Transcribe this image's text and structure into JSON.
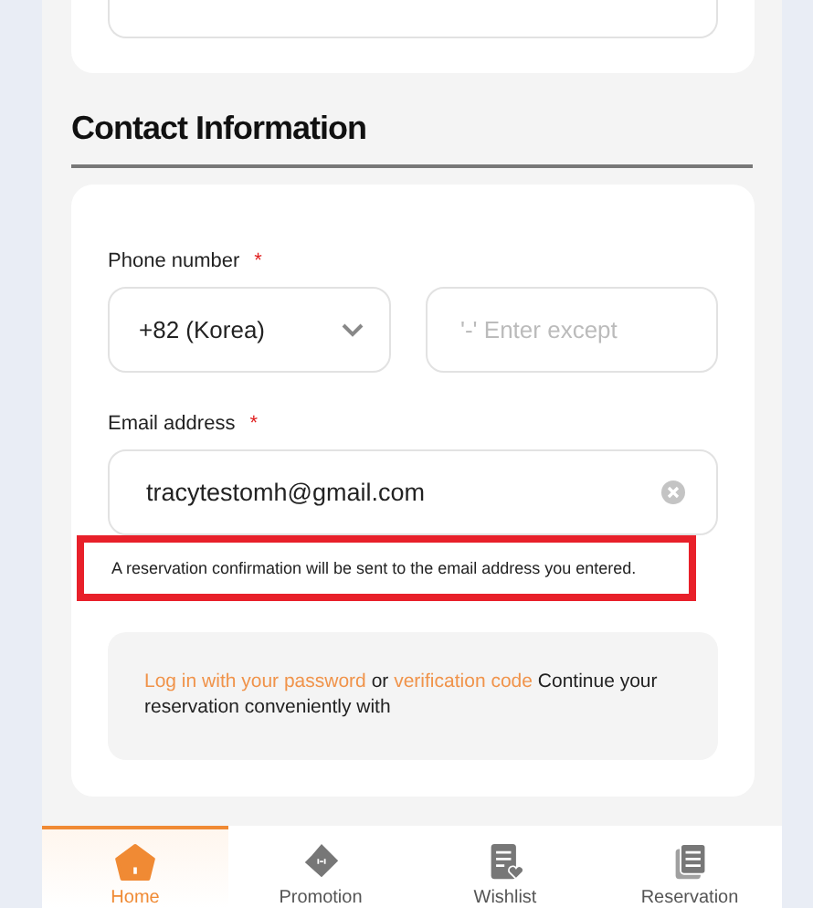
{
  "section_title": "Contact Information",
  "phone": {
    "label": "Phone number",
    "required_mark": "*",
    "country": "+82 (Korea)",
    "placeholder": "'-' Enter except"
  },
  "email": {
    "label": "Email address",
    "required_mark": "*",
    "value": "tracytestomh@gmail.com"
  },
  "notice": "A reservation confirmation will be sent to the email address you entered.",
  "login_hint": {
    "password_link": "Log in with your password",
    "or": "or",
    "code_link": "verification code",
    "rest": "Continue your reservation conveniently with"
  },
  "nav": [
    {
      "label": "Home",
      "kind": "home",
      "selected": true
    },
    {
      "label": "Promotion",
      "kind": "ticket",
      "selected": false
    },
    {
      "label": "Wishlist",
      "kind": "wishlist",
      "selected": false
    },
    {
      "label": "Reservation",
      "kind": "reservation",
      "selected": false
    }
  ]
}
